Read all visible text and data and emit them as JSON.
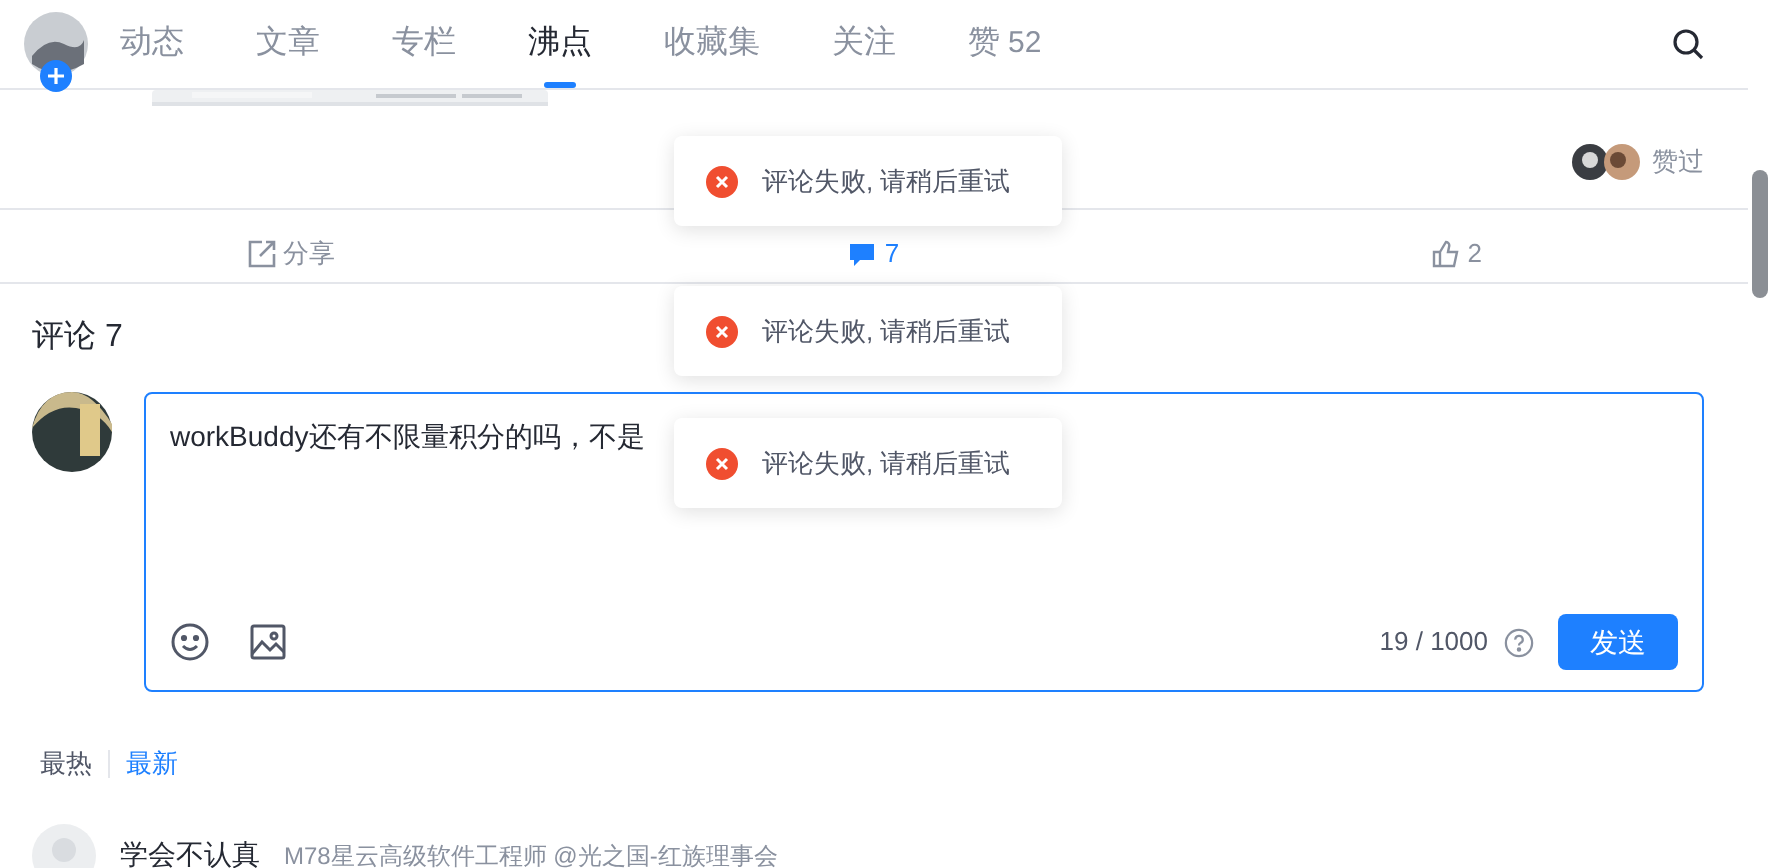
{
  "nav": {
    "tabs": [
      {
        "label": "动态",
        "selected": false
      },
      {
        "label": "文章",
        "selected": false
      },
      {
        "label": "专栏",
        "selected": false
      },
      {
        "label": "沸点",
        "selected": true
      },
      {
        "label": "收藏集",
        "selected": false
      },
      {
        "label": "关注",
        "selected": false
      },
      {
        "label": "赞",
        "count": "52",
        "selected": false
      }
    ]
  },
  "post": {
    "liked_label": "赞过"
  },
  "actions": [
    {
      "kind": "share",
      "label": "分享"
    },
    {
      "kind": "comment",
      "label": "7",
      "selected": true
    },
    {
      "kind": "like",
      "label": "2",
      "selected": false
    }
  ],
  "comments": {
    "title": "评论 7",
    "input": {
      "value": "workBuddy还有不限量积分的吗，不是",
      "counter": "19 / 1000",
      "submit": "发送"
    },
    "sort": [
      {
        "label": "最热",
        "selected": false
      },
      {
        "label": "最新",
        "selected": true
      }
    ],
    "first": {
      "author": "学会不认真",
      "subtitle": "M78星云高级软件工程师 @光之国-红族理事会"
    }
  },
  "toasts": [
    {
      "message": "评论失败, 请稍后重试"
    },
    {
      "message": "评论失败, 请稍后重试"
    },
    {
      "message": "评论失败, 请稍后重试"
    }
  ]
}
